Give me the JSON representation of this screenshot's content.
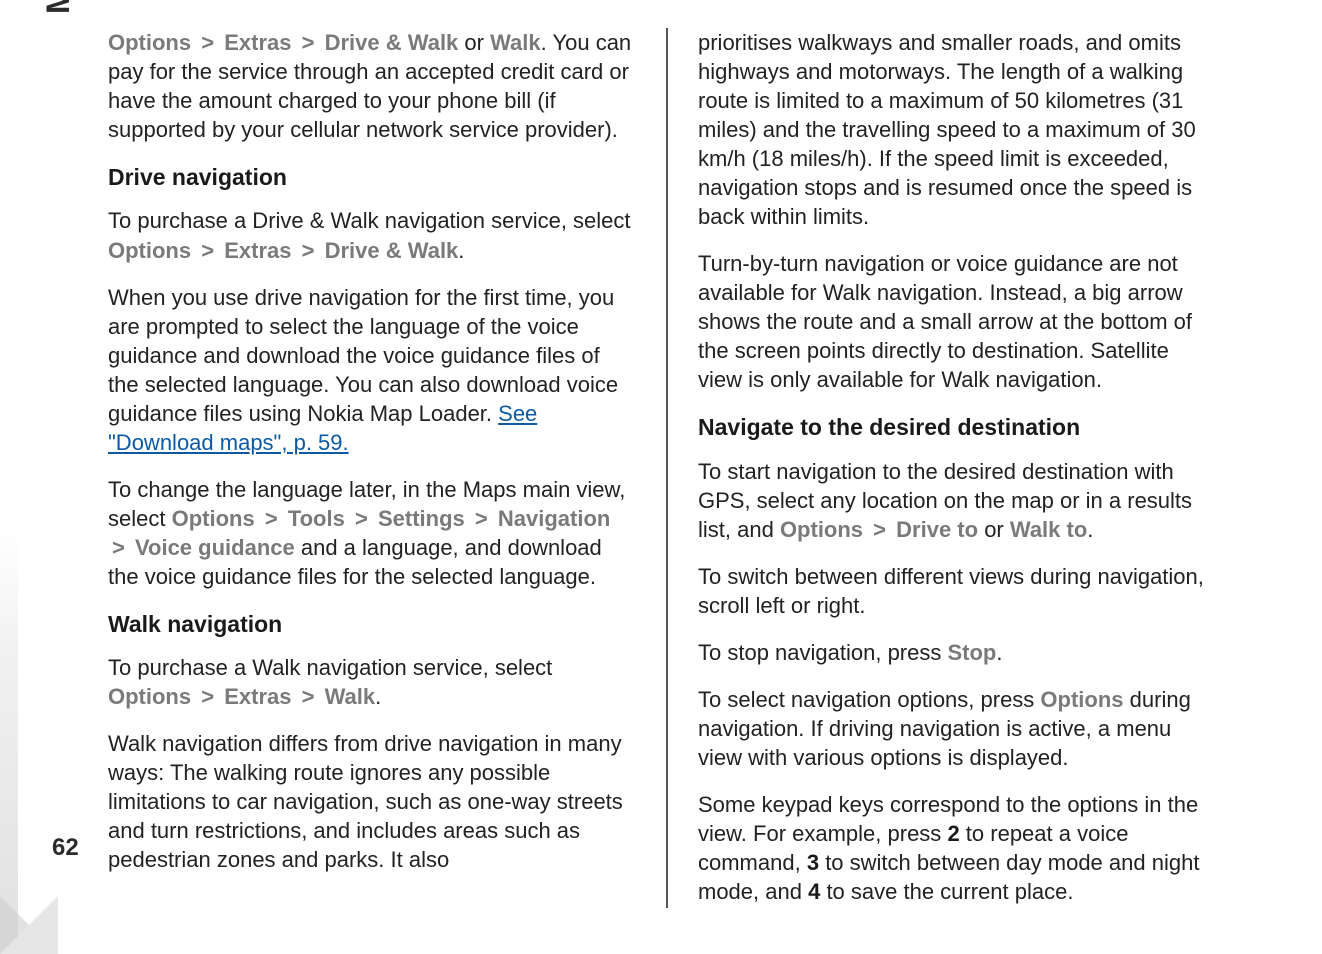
{
  "meta": {
    "sideTab": "Maps",
    "pageNumber": "62"
  },
  "left": {
    "p1": {
      "m1": "Options",
      "s1": ">",
      "m2": "Extras",
      "s2": ">",
      "m3": "Drive & Walk",
      "t1": " or ",
      "m4": "Walk",
      "t2": ". You can pay for the service through an accepted credit card or have the amount charged to your phone bill (if supported by your cellular network service provider)."
    },
    "h1": "Drive navigation",
    "p2": {
      "t1": "To purchase a Drive & Walk navigation service, select ",
      "m1": "Options",
      "s1": ">",
      "m2": "Extras",
      "s2": ">",
      "m3": "Drive & Walk",
      "t2": "."
    },
    "p3": {
      "t1": "When you use drive navigation for the first time, you are prompted to select the language of the voice guidance and download the voice guidance files of the selected language. You can also download voice guidance files using Nokia Map Loader. ",
      "link": "See \"Download maps\", p. 59."
    },
    "p4": {
      "t1": "To change the language later, in the Maps main view, select ",
      "m1": "Options",
      "s1": ">",
      "m2": "Tools",
      "s2": ">",
      "m3": "Settings",
      "s3": ">",
      "m4": "Navigation",
      "s4": ">",
      "m5": "Voice guidance",
      "t2": " and a language, and download the voice guidance files for the selected language."
    },
    "h2": "Walk navigation",
    "p5": {
      "t1": "To purchase a Walk navigation service, select ",
      "m1": "Options",
      "s1": ">",
      "m2": "Extras",
      "s2": ">",
      "m3": "Walk",
      "t2": "."
    },
    "p6": "Walk navigation differs from drive navigation in many ways: The walking route ignores any possible limitations to car navigation, such as one-way streets and turn restrictions, and includes areas such as pedestrian zones and parks. It also"
  },
  "right": {
    "p1": "prioritises walkways and smaller roads, and omits highways and motorways. The length of a walking route is limited to a maximum of 50 kilometres (31 miles) and the travelling speed to a maximum of 30 km/h (18 miles/h). If the speed limit is exceeded, navigation stops and is resumed once the speed is back within limits.",
    "p2": "Turn-by-turn navigation or voice guidance are not available for Walk navigation. Instead, a big arrow shows the route and a small arrow at the bottom of the screen points directly to destination. Satellite view is only available for Walk navigation.",
    "h1": "Navigate to the desired destination",
    "p3": {
      "t1": "To start navigation to the desired destination with GPS, select any location on the map or in a results list, and ",
      "m1": "Options",
      "s1": ">",
      "m2": "Drive to",
      "t2": " or ",
      "m3": "Walk to",
      "t3": "."
    },
    "p4": "To switch between different views during navigation, scroll left or right.",
    "p5": {
      "t1": "To stop navigation, press ",
      "m1": "Stop",
      "t2": "."
    },
    "p6": {
      "t1": "To select navigation options, press ",
      "m1": "Options",
      "t2": " during navigation. If driving navigation is active, a menu view with various options is displayed."
    },
    "p7": {
      "t1": "Some keypad keys correspond to the options in the view. For example, press ",
      "b1": "2",
      "t2": " to repeat a voice command, ",
      "b2": "3",
      "t3": " to switch between day mode and night mode, and ",
      "b3": "4",
      "t4": " to save the current place."
    }
  }
}
